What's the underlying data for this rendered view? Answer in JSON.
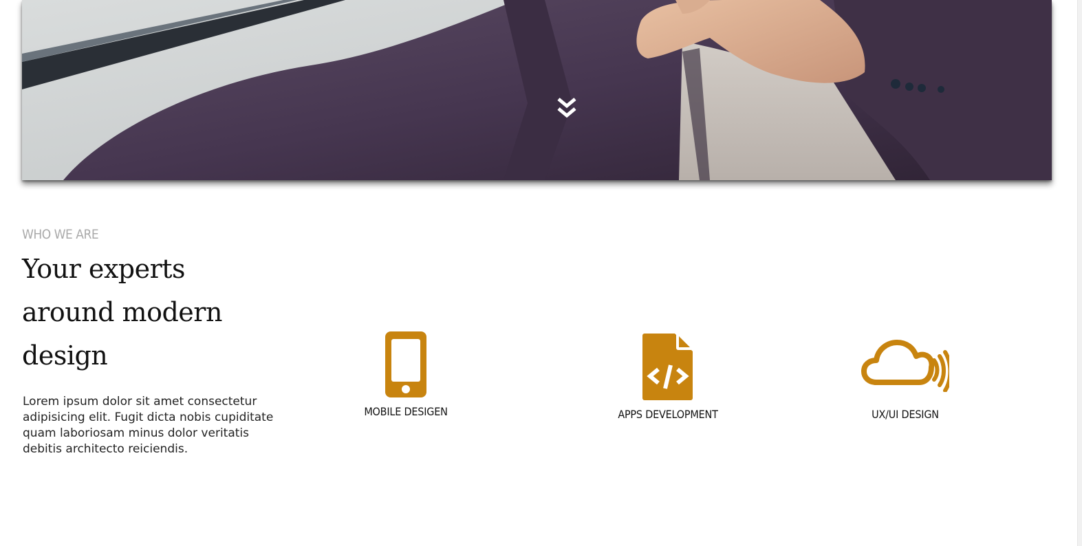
{
  "hero": {
    "scroll_icon": "double-chevron-down-icon"
  },
  "about": {
    "eyebrow": "WHO WE ARE",
    "headline": "Your experts around modern design",
    "body": "Lorem ipsum dolor sit amet consectetur adipisicing elit. Fugit dicta nobis cupiditate quam laboriosam minus dolor veritatis debitis architecto reiciendis."
  },
  "services": [
    {
      "label": "MOBILE DESIGEN",
      "icon": "mobile-phone-icon"
    },
    {
      "label": "APPS DEVELOPMENT",
      "icon": "code-file-icon"
    },
    {
      "label": "UX/UI DESIGN",
      "icon": "cloud-signal-icon"
    }
  ],
  "colors": {
    "accent": "#c8840f",
    "jacket": "#4a3a50",
    "text": "#111111",
    "muted": "#aaaaaa"
  }
}
